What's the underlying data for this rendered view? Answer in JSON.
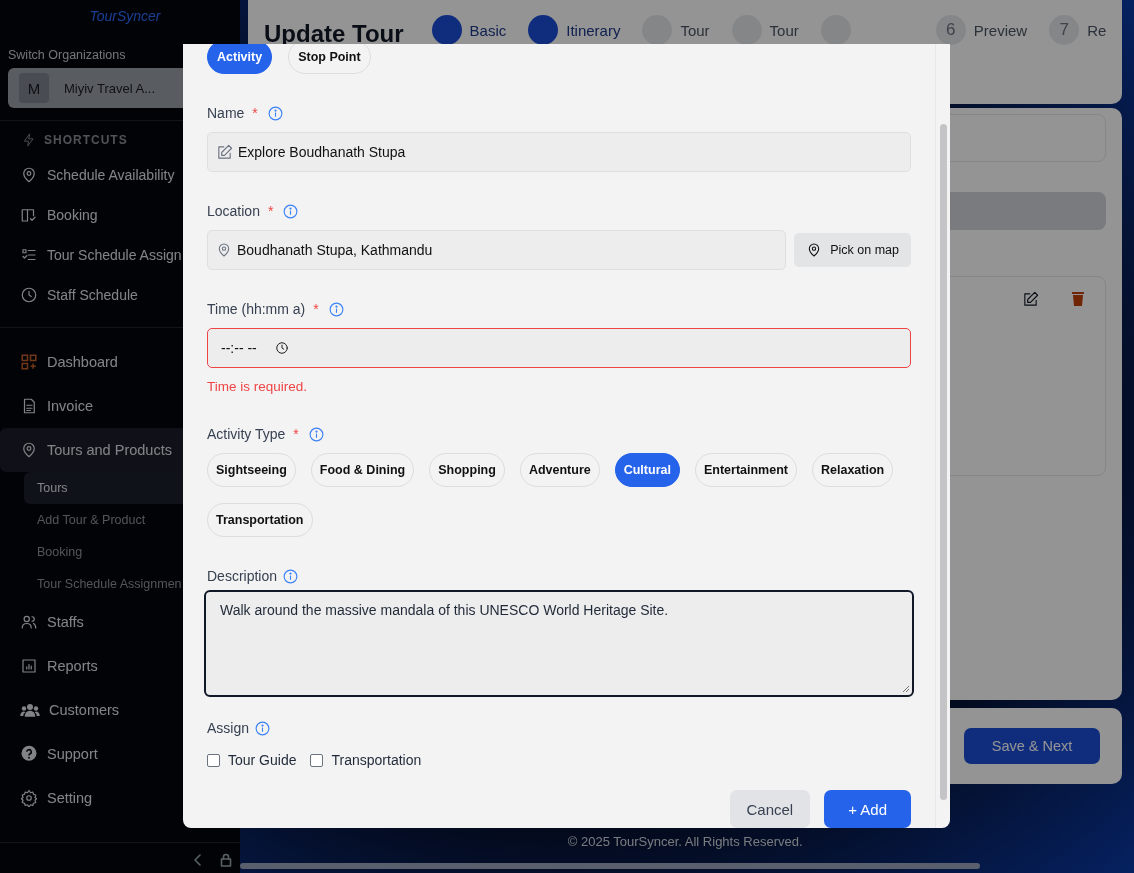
{
  "sidebar": {
    "logo": "TourSyncer",
    "org_label": "Switch Organizations",
    "org": {
      "initial": "M",
      "name": "Miyiv Travel A..."
    },
    "shortcuts_heading": "SHORTCUTS",
    "shortcuts": [
      {
        "label": "Schedule Availability"
      },
      {
        "label": "Booking"
      },
      {
        "label": "Tour Schedule Assign"
      },
      {
        "label": "Staff Schedule"
      }
    ],
    "nav": [
      {
        "label": "Dashboard",
        "selected": false
      },
      {
        "label": "Invoice",
        "selected": false
      },
      {
        "label": "Tours and Products",
        "selected": true,
        "children": [
          {
            "label": "Tours",
            "selected": true
          },
          {
            "label": "Add Tour & Product",
            "selected": false
          },
          {
            "label": "Booking",
            "selected": false
          },
          {
            "label": "Tour Schedule Assignmen",
            "selected": false
          }
        ]
      },
      {
        "label": "Staffs",
        "selected": false
      },
      {
        "label": "Reports",
        "selected": false
      },
      {
        "label": "Customers",
        "selected": false
      },
      {
        "label": "Support",
        "selected": false
      },
      {
        "label": "Setting",
        "selected": false
      }
    ]
  },
  "page": {
    "title": "Update Tour",
    "steps": [
      {
        "label": "Basic",
        "done": true
      },
      {
        "label": "Itinerary",
        "done": true
      },
      {
        "label": "Tour",
        "done": false
      },
      {
        "label": "Tour",
        "done": false
      },
      {
        "done": false
      },
      {
        "number": "6",
        "label": "Preview",
        "done": false
      },
      {
        "number": "7",
        "label": "Re",
        "done": false
      }
    ],
    "save_button": "Save & Next",
    "footer": "© 2025 TourSyncer. All Rights Reserved."
  },
  "modal": {
    "tabs": [
      {
        "label": "Activity",
        "selected": true
      },
      {
        "label": "Stop Point",
        "selected": false
      }
    ],
    "required_mark": "*",
    "fields": [
      {
        "kind": "text",
        "label": "Name",
        "required": true,
        "value": "Explore Boudhanath Stupa"
      },
      {
        "kind": "location",
        "label": "Location",
        "required": true,
        "value": "Boudhanath Stupa, Kathmandu",
        "button": "Pick on map"
      },
      {
        "kind": "time",
        "label": "Time (hh:mm a)",
        "required": true,
        "value": "--:-- --",
        "error": "Time is required."
      },
      {
        "kind": "chips",
        "label": "Activity Type",
        "required": true,
        "options": [
          {
            "label": "Sightseeing",
            "selected": false
          },
          {
            "label": "Food & Dining",
            "selected": false
          },
          {
            "label": "Shopping",
            "selected": false
          },
          {
            "label": "Adventure",
            "selected": false
          },
          {
            "label": "Cultural",
            "selected": true
          },
          {
            "label": "Entertainment",
            "selected": false
          },
          {
            "label": "Relaxation",
            "selected": false
          },
          {
            "label": "Transportation",
            "selected": false
          }
        ]
      },
      {
        "kind": "textarea",
        "label": "Description",
        "required": false,
        "value": "Walk around the massive mandala of this UNESCO World Heritage Site."
      },
      {
        "kind": "checks",
        "label": "Assign",
        "required": false,
        "options": [
          {
            "label": "Tour Guide",
            "checked": false
          },
          {
            "label": "Transportation",
            "checked": false
          }
        ]
      }
    ],
    "buttons": {
      "cancel": "Cancel",
      "add": "+ Add"
    }
  }
}
